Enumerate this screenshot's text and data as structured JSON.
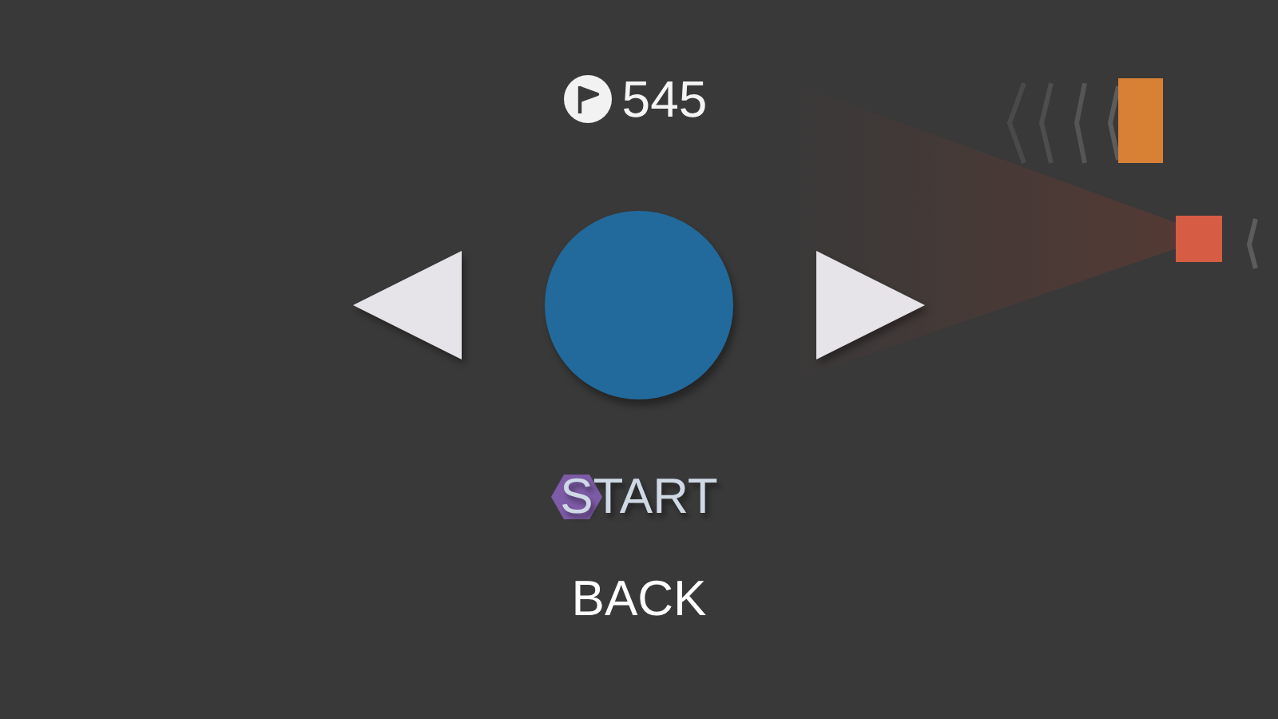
{
  "score": {
    "value": "545"
  },
  "menu": [
    {
      "label": "START",
      "selected": true
    },
    {
      "label": "BACK",
      "selected": false
    }
  ]
}
